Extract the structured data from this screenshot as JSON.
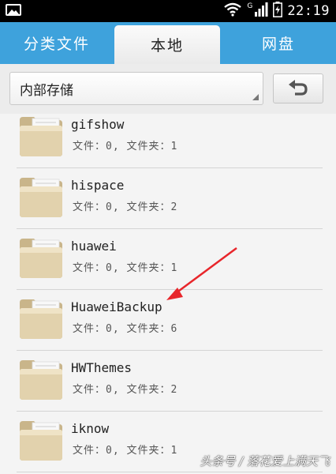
{
  "status": {
    "signal_label": "G",
    "time": "22:19"
  },
  "tabs": [
    {
      "label": "分类文件",
      "active": false
    },
    {
      "label": "本地",
      "active": true
    },
    {
      "label": "网盘",
      "active": false
    }
  ],
  "path": {
    "current": "内部存储"
  },
  "folders": [
    {
      "name": "gifshow",
      "meta": "文件：0, 文件夹：1"
    },
    {
      "name": "hispace",
      "meta": "文件：0, 文件夹：2"
    },
    {
      "name": "huawei",
      "meta": "文件：0, 文件夹：1"
    },
    {
      "name": "HuaweiBackup",
      "meta": "文件：0, 文件夹：6"
    },
    {
      "name": "HWThemes",
      "meta": "文件：0, 文件夹：2"
    },
    {
      "name": "iknow",
      "meta": "文件：0, 文件夹：1"
    }
  ],
  "watermark": "头条号 / 落花爱上满天飞",
  "colors": {
    "accent": "#3ea2dc",
    "arrow": "#e8262b"
  }
}
